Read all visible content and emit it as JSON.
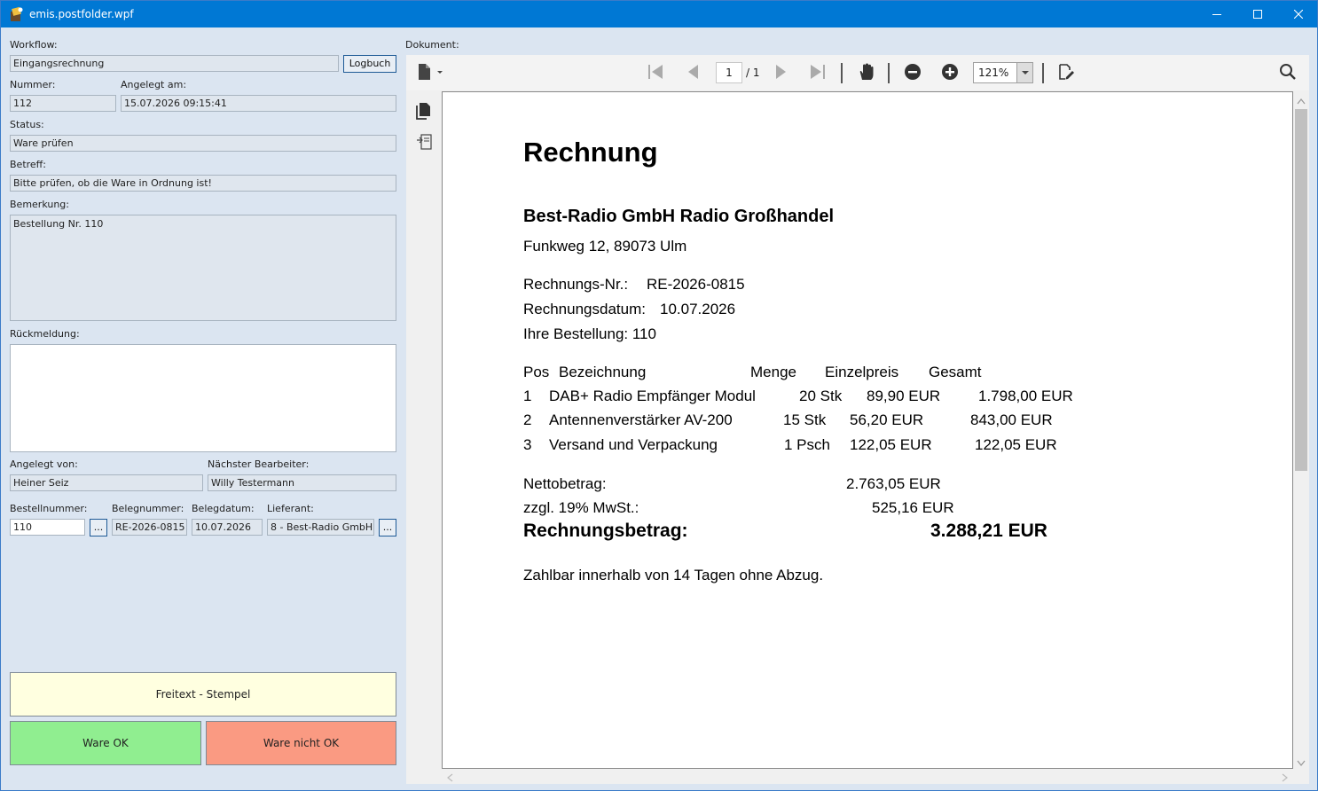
{
  "window": {
    "title": "emis.postfolder.wpf"
  },
  "form": {
    "workflow_label": "Workflow:",
    "workflow_value": "Eingangsrechnung",
    "logbuch_label": "Logbuch",
    "nummer_label": "Nummer:",
    "nummer_value": "112",
    "angelegt_am_label": "Angelegt am:",
    "angelegt_am_value": "15.07.2026 09:15:41",
    "status_label": "Status:",
    "status_value": "Ware prüfen",
    "betreff_label": "Betreff:",
    "betreff_value": "Bitte prüfen, ob die Ware in Ordnung ist!",
    "bemerkung_label": "Bemerkung:",
    "bemerkung_value": "Bestellung Nr. 110",
    "rueckmeldung_label": "Rückmeldung:",
    "rueckmeldung_value": "",
    "angelegt_von_label": "Angelegt von:",
    "angelegt_von_value": "Heiner Seiz",
    "naechster_label": "Nächster Bearbeiter:",
    "naechster_value": "Willy Testermann",
    "bestellnummer_label": "Bestellnummer:",
    "bestellnummer_value": "110",
    "belegnummer_label": "Belegnummer:",
    "belegnummer_value": "RE-2026-0815",
    "belegdatum_label": "Belegdatum:",
    "belegdatum_value": "10.07.2026",
    "lieferant_label": "Lieferant:",
    "lieferant_value": "8 - Best-Radio GmbH",
    "ellipsis": "..."
  },
  "actions": {
    "freitext": "Freitext - Stempel",
    "ware_ok": "Ware OK",
    "ware_nicht_ok": "Ware nicht OK",
    "colors": {
      "freitext": "#ffffe0",
      "ok": "#90ee90",
      "nicht_ok": "#fa9a82"
    }
  },
  "viewer": {
    "label": "Dokument:",
    "page_current": "1",
    "page_total": "/ 1",
    "zoom": "121%",
    "icons": [
      "file-icon",
      "first-page-icon",
      "prev-page-icon",
      "next-page-icon",
      "last-page-icon",
      "hand-tool-icon",
      "zoom-out-icon",
      "zoom-in-icon",
      "sign-icon",
      "search-icon",
      "pages-icon",
      "bookmark-icon"
    ]
  },
  "document": {
    "title": "Rechnung",
    "company": "Best-Radio GmbH Radio Großhandel",
    "address": "Funkweg 12, 89073 Ulm",
    "rechnungsnr_label": "Rechnungs-Nr.:",
    "rechnungsnr_value": "RE-2026-0815",
    "rechnungsdatum_label": "Rechnungsdatum:",
    "rechnungsdatum_value": "10.07.2026",
    "bestellung": "Ihre Bestellung: 110",
    "table_header": {
      "pos": "Pos",
      "bez": "Bezeichnung",
      "menge": "Menge",
      "einzel": "Einzelpreis",
      "gesamt": "Gesamt"
    },
    "items": [
      {
        "pos": "1",
        "bez": "DAB+ Radio Empfänger Modul",
        "menge": "20 Stk",
        "einzel": "89,90 EUR",
        "gesamt": "1.798,00 EUR"
      },
      {
        "pos": "2",
        "bez": "Antennenverstärker AV-200",
        "menge": "15 Stk",
        "einzel": "56,20 EUR",
        "gesamt": "843,00 EUR"
      },
      {
        "pos": "3",
        "bez": "Versand und Verpackung",
        "menge": "1 Psch",
        "einzel": "122,05 EUR",
        "gesamt": "122,05 EUR"
      }
    ],
    "netto_label": "Nettobetrag:",
    "netto_value": "2.763,05 EUR",
    "mwst_label": "zzgl. 19% MwSt.:",
    "mwst_value": "525,16 EUR",
    "brutto_label": "Rechnungsbetrag:",
    "brutto_value": "3.288,21 EUR",
    "zahlbar": "Zahlbar innerhalb von 14 Tagen ohne Abzug."
  }
}
